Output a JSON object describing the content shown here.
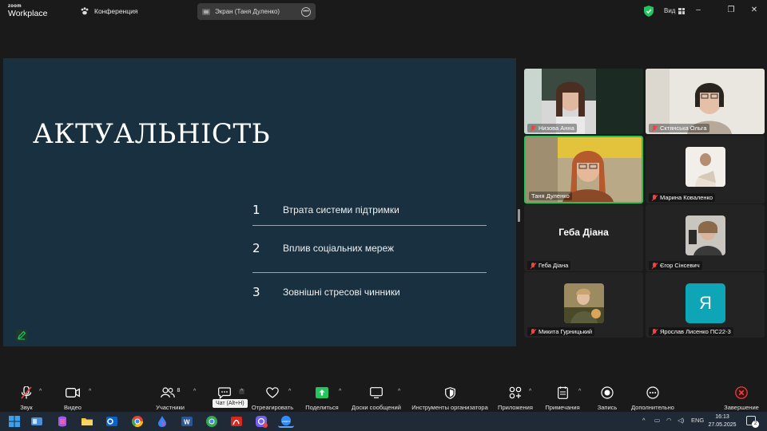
{
  "topbar": {
    "logo_line1": "zoom",
    "logo_line2": "Workplace",
    "conference_label": "Конференция",
    "screen_share_label": "Экран (Таня Дуленко)",
    "view_label": "Вид"
  },
  "slide": {
    "title": "АКТУАЛЬНІСТЬ",
    "items": [
      {
        "num": "1",
        "text": "Втрата системи підтримки"
      },
      {
        "num": "2",
        "text": "Вплив соціальних мереж"
      },
      {
        "num": "3",
        "text": "Зовнішні стресові чинники"
      }
    ]
  },
  "gallery": {
    "tiles": [
      {
        "name": "Низова Анна"
      },
      {
        "name": "Сктянська Ольга"
      },
      {
        "name": "Таня Дуленко"
      },
      {
        "name": "Марина Коваленко"
      },
      {
        "name": "Геба Діана",
        "big_name": "Геба Діана"
      },
      {
        "name": "Єгор Сінсевич"
      },
      {
        "name": "Микита Гурницький"
      },
      {
        "name": "Ярослав Лисенко ПС22-3",
        "letter": "Я"
      }
    ]
  },
  "toolbar": {
    "audio": "Звук",
    "video": "Видео",
    "participants": "Участники",
    "participants_count": "8",
    "chat_tooltip": "Чат (Alt+H)",
    "react": "Отреагировать",
    "share": "Поделиться",
    "whiteboards": "Доски сообщений",
    "host_tools": "Инструменты организатора",
    "apps": "Приложения",
    "notes": "Примечания",
    "record": "Запись",
    "more": "Дополнительно",
    "end": "Завершение"
  },
  "taskbar": {
    "lang": "ENG",
    "time": "16:13",
    "date": "27.05.2025",
    "notif_count": "2"
  },
  "colors": {
    "slide_bg": "#18303f",
    "active_speaker": "#22c55e",
    "end_red": "#ef4444",
    "share_green": "#22c55e",
    "letter_avatar": "#0ea5b7"
  }
}
